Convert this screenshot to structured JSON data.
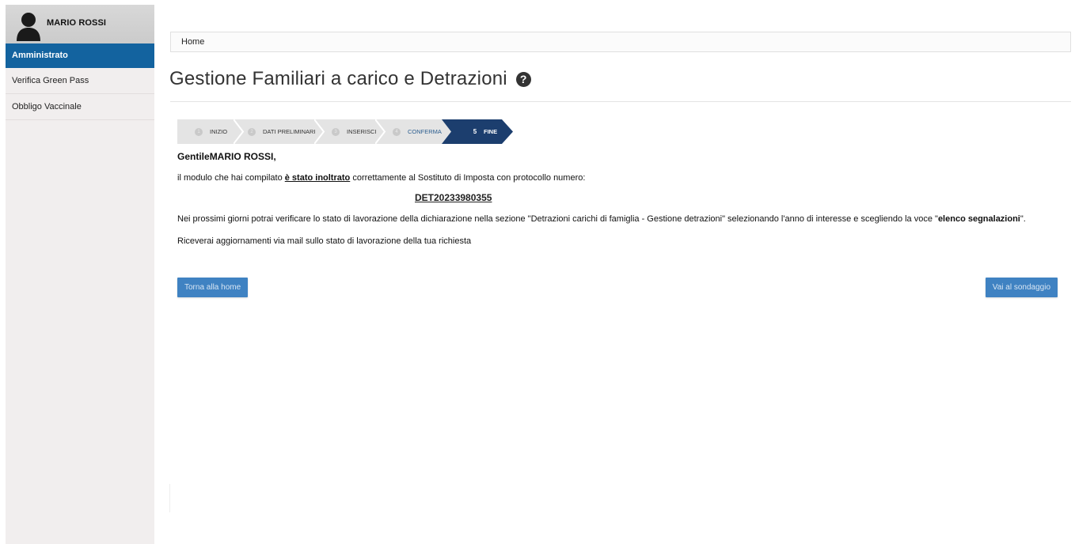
{
  "user": {
    "name": "MARIO ROSSI"
  },
  "sidebar": {
    "items": [
      {
        "label": "Amministrato",
        "active": true
      },
      {
        "label": "Verifica Green Pass",
        "active": false
      },
      {
        "label": "Obbligo Vaccinale",
        "active": false
      }
    ]
  },
  "breadcrumb": {
    "home": "Home"
  },
  "page": {
    "title": "Gestione Familiari a carico e Detrazioni",
    "help_icon": "?"
  },
  "stepper": {
    "steps": [
      {
        "num": "1",
        "label": "INIZIO"
      },
      {
        "num": "2",
        "label": "DATI PRELIMINARI"
      },
      {
        "num": "3",
        "label": "INSERISCI"
      },
      {
        "num": "4",
        "label": "CONFERMA"
      },
      {
        "num": "5",
        "label": "FINE"
      }
    ],
    "active_index": 4
  },
  "message": {
    "greeting_prefix": "Gentile",
    "greeting_name": "MARIO ROSSI",
    "greeting_suffix": ",",
    "line1_before": "il modulo che hai compilato ",
    "line1_emphasis": "è stato inoltrato",
    "line1_after": " correttamente al Sostituto di Imposta con protocollo numero:",
    "protocol_number": "DET20233980355",
    "line2_before": "Nei prossimi giorni potrai verificare lo stato di lavorazione della dichiarazione nella sezione \"Detrazioni carichi di famiglia - Gestione detrazioni\" selezionando l'anno di interesse e scegliendo la voce \"",
    "line2_emphasis": "elenco segnalazioni",
    "line2_after": "\".",
    "line3": "Riceverai aggiornamenti via mail sullo stato di lavorazione della tua richiesta"
  },
  "buttons": {
    "home": "Torna alla home",
    "survey": "Vai al sondaggio"
  },
  "colors": {
    "sidebar_active": "#13639f",
    "step_active": "#1c3e6e",
    "step_inactive": "#e4e4e4",
    "button": "#3f82c2"
  }
}
